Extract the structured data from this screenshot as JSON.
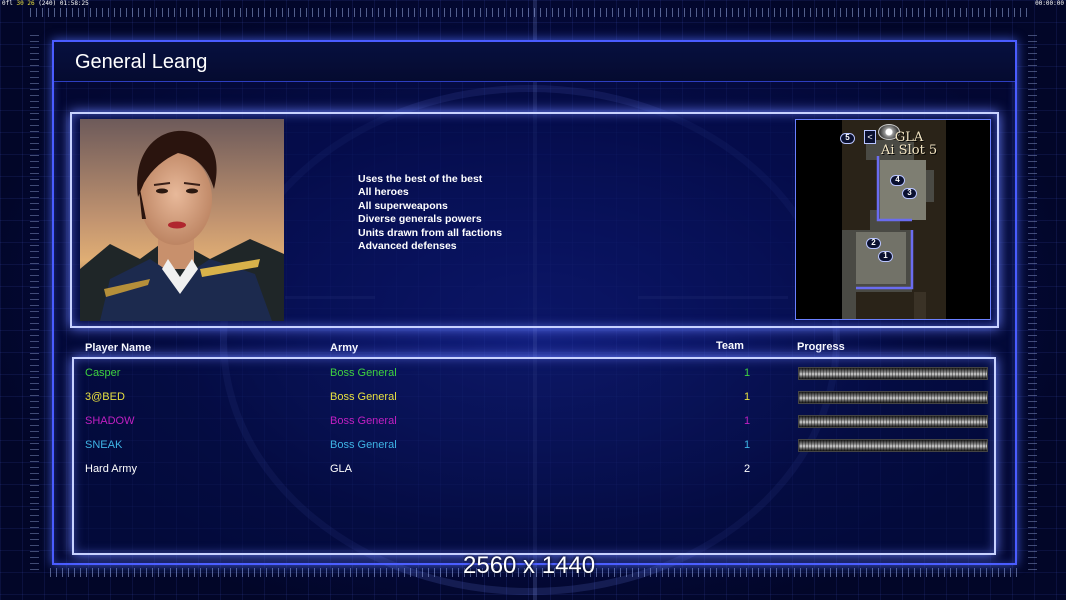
{
  "hud": {
    "left_prefix": "0fl",
    "left_fps": "30",
    "left_fps2": "26",
    "left_paren": "(240)",
    "left_clock": "01:58:25",
    "right_clock": "00:00:00"
  },
  "general": {
    "name": "General Leang",
    "features": [
      "Uses the best of the best",
      "All heroes",
      "All superweapons",
      "Diverse generals powers",
      "Units drawn from all factions",
      "Advanced defenses"
    ]
  },
  "minimap": {
    "slot_label_line1": "GLA",
    "slot_label_line2": "Ai Slot 5",
    "markers": [
      "1",
      "2",
      "3",
      "4",
      "5"
    ]
  },
  "table": {
    "headers": {
      "player_name": "Player Name",
      "army": "Army",
      "team": "Team",
      "progress": "Progress"
    },
    "rows": [
      {
        "name": "Casper",
        "army": "Boss General",
        "team": "1",
        "color": "#3fd23f",
        "progress": 1.0
      },
      {
        "name": "3@BED",
        "army": "Boss General",
        "team": "1",
        "color": "#e8e040",
        "progress": 1.0
      },
      {
        "name": "SHADOW",
        "army": "Boss General",
        "team": "1",
        "color": "#c21fc2",
        "progress": 1.0
      },
      {
        "name": "SNEAK",
        "army": "Boss General",
        "team": "1",
        "color": "#3fb4e6",
        "progress": 1.0
      },
      {
        "name": "Hard Army",
        "army": "GLA",
        "team": "2",
        "color": "#ffffff",
        "progress": null
      }
    ]
  },
  "resolution": "2560 x 1440"
}
